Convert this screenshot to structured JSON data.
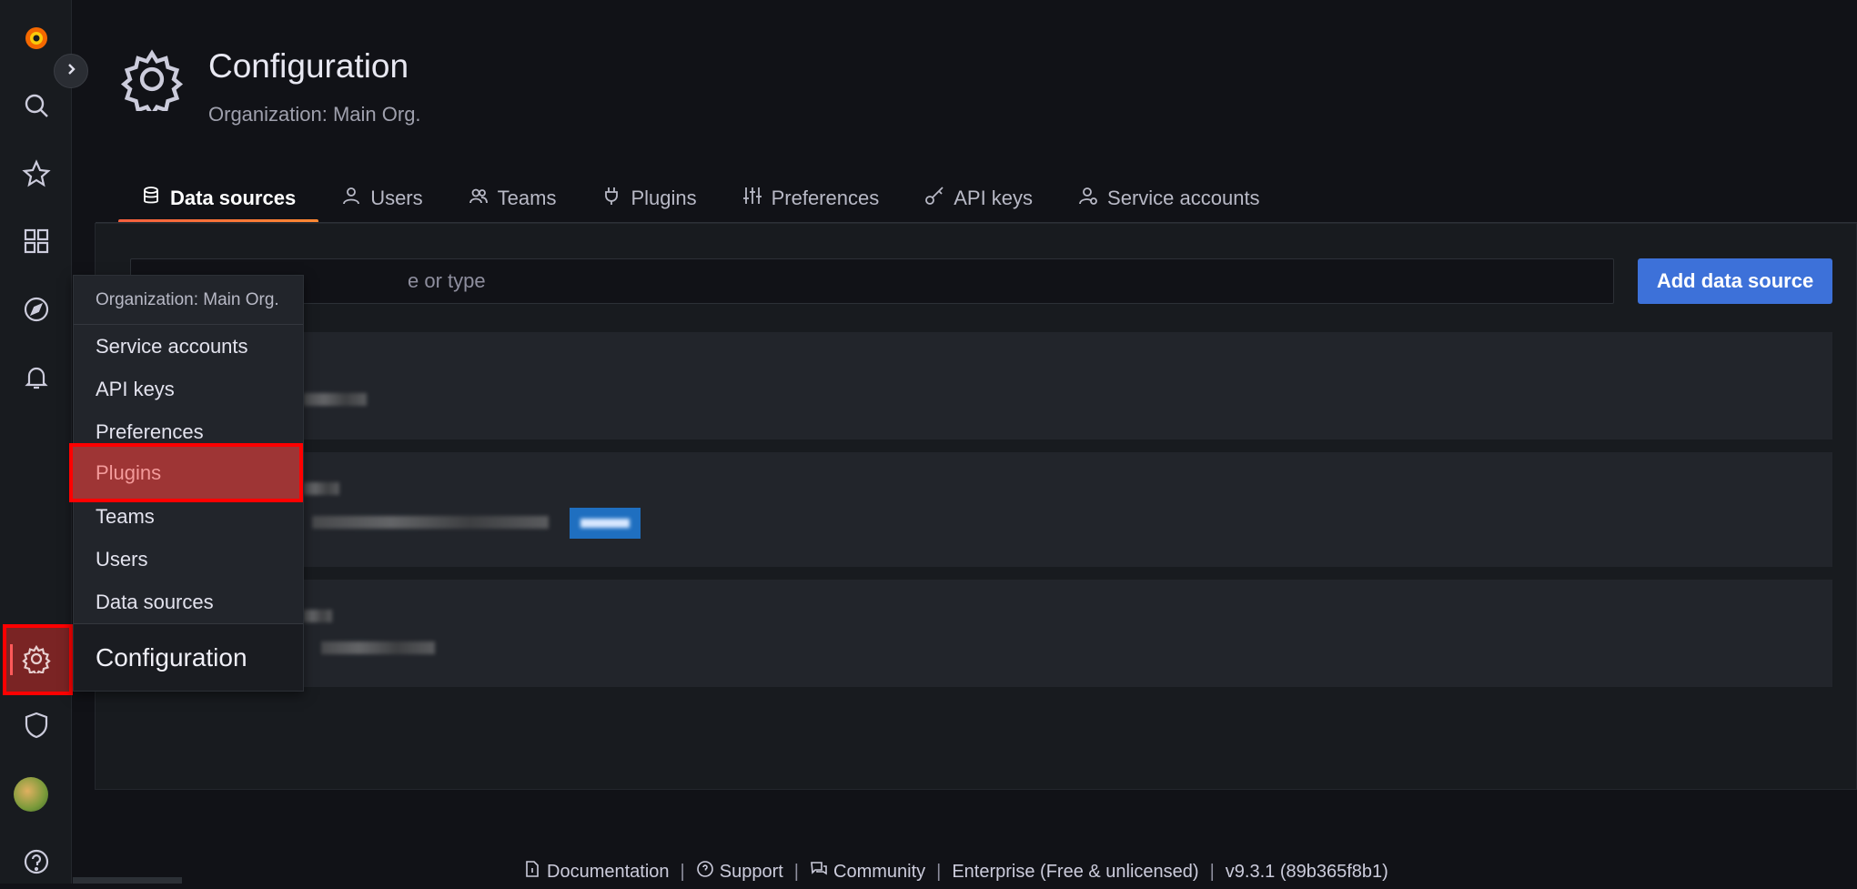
{
  "sidebar": {
    "icons": [
      "grafana-logo-icon",
      "search-icon",
      "star-icon",
      "dashboards-icon",
      "explore-icon",
      "alerting-icon",
      "configuration-icon",
      "shield-icon",
      "avatar",
      "help-icon"
    ]
  },
  "header": {
    "title": "Configuration",
    "subtitle": "Organization: Main Org."
  },
  "tabs": [
    {
      "label": "Data sources",
      "icon": "database-icon",
      "active": true
    },
    {
      "label": "Users",
      "icon": "user-icon"
    },
    {
      "label": "Teams",
      "icon": "users-icon"
    },
    {
      "label": "Plugins",
      "icon": "plug-icon"
    },
    {
      "label": "Preferences",
      "icon": "sliders-icon"
    },
    {
      "label": "API keys",
      "icon": "key-icon"
    },
    {
      "label": "Service accounts",
      "icon": "service-account-icon"
    }
  ],
  "search": {
    "visible_text": "e or type"
  },
  "actions": {
    "add_label": "Add data source"
  },
  "flyout": {
    "header": "Organization: Main Org.",
    "items": [
      "Service accounts",
      "API keys",
      "Preferences",
      "Plugins",
      "Teams",
      "Users",
      "Data sources"
    ],
    "highlighted": "Plugins",
    "footer": "Configuration"
  },
  "footer": {
    "documentation": "Documentation",
    "support": "Support",
    "community": "Community",
    "edition": "Enterprise (Free & unlicensed)",
    "version": "v9.3.1 (89b365f8b1)",
    "separator": "|"
  },
  "colors": {
    "accent_tab": "#ff7a3a",
    "primary_button": "#3d71d9",
    "highlight_border": "#ff0000"
  }
}
